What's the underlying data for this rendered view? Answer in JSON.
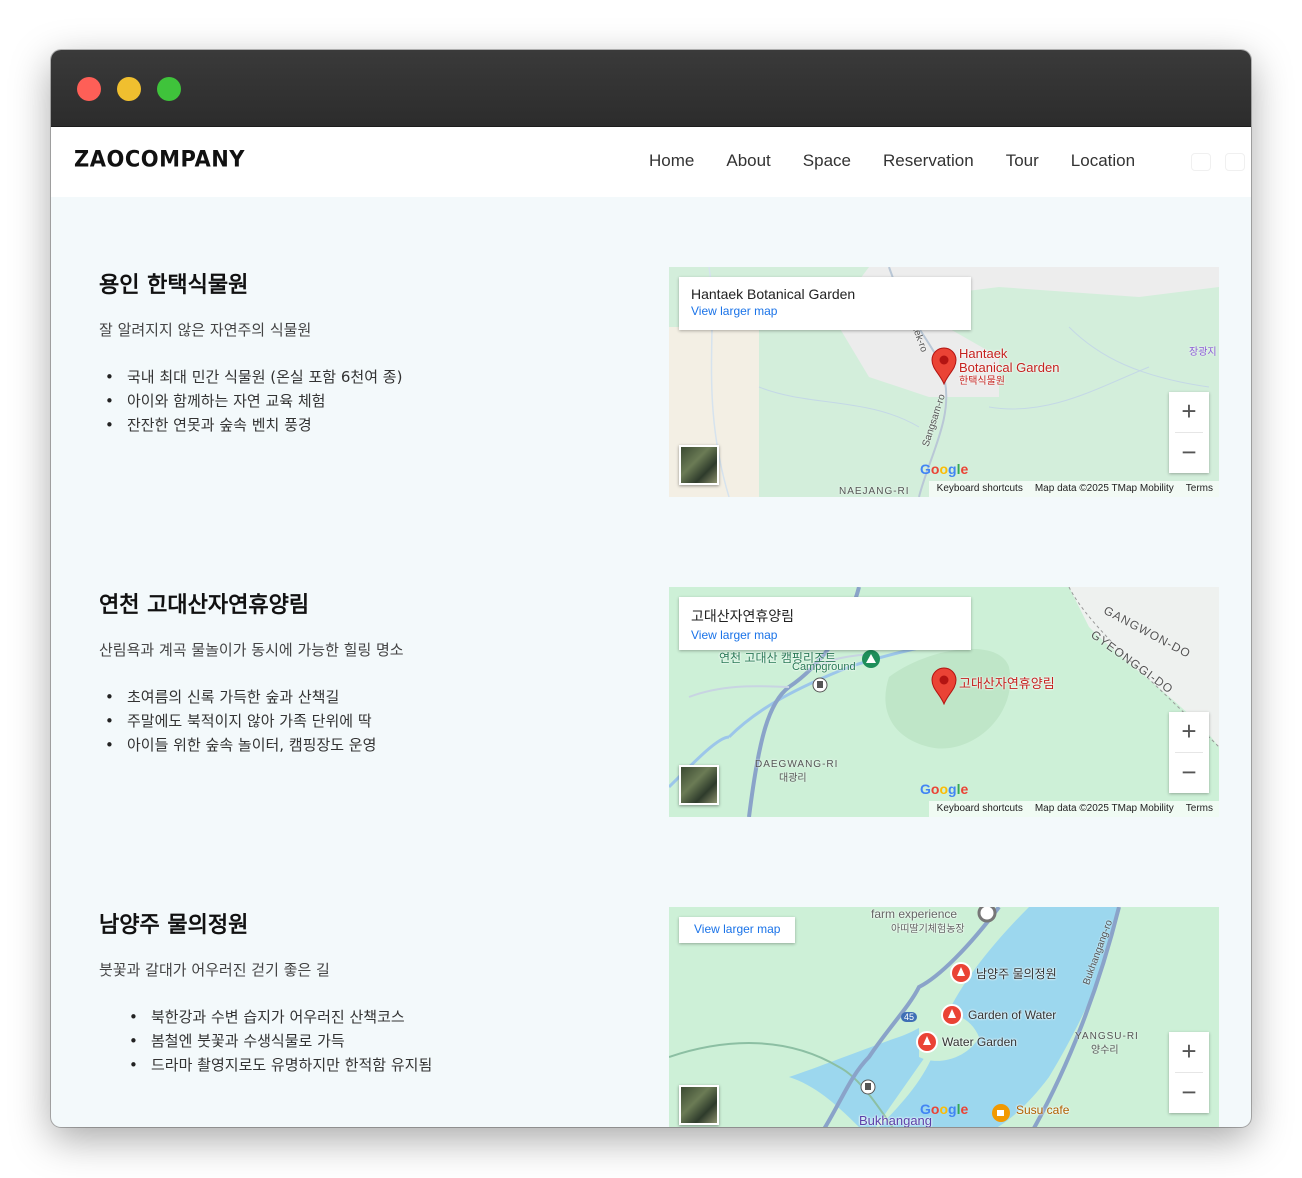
{
  "window": {
    "controls": [
      "close",
      "minimize",
      "maximize"
    ]
  },
  "header": {
    "logo": "ZAOCOMPANY",
    "nav": [
      "Home",
      "About",
      "Space",
      "Reservation",
      "Tour",
      "Location"
    ]
  },
  "sections": [
    {
      "title": "용인 한택식물원",
      "subtitle": "잘 알려지지 않은 자연주의 식물원",
      "bullets": [
        "국내 최대 민간 식물원 (온실 포함 6천여 종)",
        "아이와 함께하는 자연 교육 체험",
        "잔잔한 연못과 숲속 벤치 풍경"
      ],
      "map": {
        "card_title": "Hantaek Botanical Garden",
        "card_link": "View larger map",
        "pin_label_line1": "Hantaek",
        "pin_label_line2": "Botanical Garden",
        "pin_label_ko": "한택식물원",
        "labels": [
          "Sangsam-ro",
          "NAEJANG-RI",
          "장광지",
          "aek-ro"
        ],
        "attribution": [
          "Keyboard shortcuts",
          "Map data ©2025 TMap Mobility",
          "Terms"
        ]
      }
    },
    {
      "title": "연천 고대산자연휴양림",
      "subtitle": "산림욕과 계곡 물놀이가 동시에 가능한 힐링 명소",
      "bullets": [
        "초여름의 신록 가득한 숲과 산책길",
        "주말에도 북적이지 않아 가족 단위에 딱",
        "아이들 위한 숲속 놀이터, 캠핑장도 운영"
      ],
      "map": {
        "card_title": "고대산자연휴양림",
        "card_link": "View larger map",
        "pin_label": "고대산자연휴양림",
        "labels": [
          "GANGWON-DO",
          "GYEONGGI-DO",
          "DAEGWANG-RI",
          "대광리",
          "연천 고대산 캠핑리조트",
          "Campground"
        ],
        "attribution": [
          "Keyboard shortcuts",
          "Map data ©2025 TMap Mobility",
          "Terms"
        ]
      }
    },
    {
      "title": "남양주 물의정원",
      "subtitle": "붓꽃과 갈대가 어우러진 걷기 좋은 길",
      "bullets": [
        "북한강과 수변 습지가 어우러진 산책코스",
        "봄철엔 붓꽃과 수생식물로 가득",
        "드라마 촬영지로도 유명하지만 한적함 유지됨"
      ],
      "map": {
        "card_link": "View larger map",
        "labels": [
          "farm experience",
          "아띠딸기체험농장",
          "남양주 물의정원",
          "Garden of Water",
          "Water Garden",
          "YANGSU-RI",
          "양수리",
          "Susu cafe",
          "Bukhangang",
          "Bukhangang-ro",
          "45"
        ]
      }
    }
  ],
  "map_controls": {
    "zoom_in": "+",
    "zoom_out": "−",
    "google": [
      "G",
      "o",
      "o",
      "g",
      "l",
      "e"
    ]
  },
  "colors": {
    "pin": "#ea4335",
    "link": "#1a73e8",
    "water": "#9cd7ee",
    "park": "#c9ecd4",
    "page_bg": "#f3f9fb"
  }
}
